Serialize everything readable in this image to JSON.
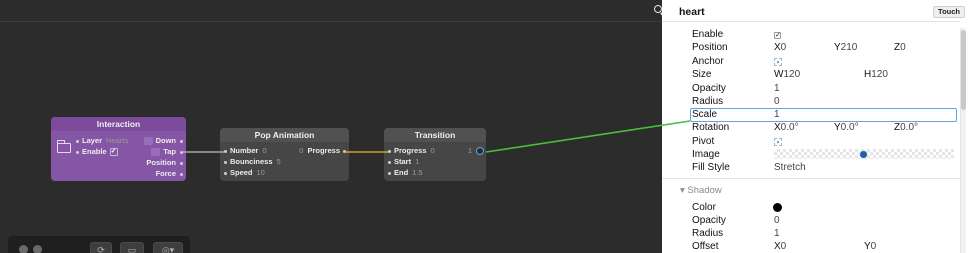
{
  "canvas": {
    "nodes": {
      "interaction": {
        "title": "Interaction",
        "inputs": [
          {
            "label": "Layer",
            "value": "Hearts"
          },
          {
            "label": "Enable",
            "value": "✓"
          }
        ],
        "outputs": [
          "Down",
          "Tap",
          "Position",
          "Force"
        ]
      },
      "pop": {
        "title": "Pop Animation",
        "inputs": [
          {
            "label": "Number",
            "value": "0"
          },
          {
            "label": "Bounciness",
            "value": "5"
          },
          {
            "label": "Speed",
            "value": "10"
          }
        ],
        "output": {
          "label": "Progress",
          "value": "0"
        }
      },
      "transition": {
        "title": "Transition",
        "inputs": [
          {
            "label": "Progress",
            "value": "0"
          },
          {
            "label": "Start",
            "value": "1"
          },
          {
            "label": "End",
            "value": "1.5"
          }
        ],
        "output": {
          "label": "",
          "value": "1"
        }
      }
    },
    "wire_colors": {
      "gray": "#bdbdbd",
      "yellow": "#e8b92e",
      "green": "#4bbd3f"
    },
    "toolbar_icons": [
      "record-icon",
      "refresh-icon",
      "camera-icon",
      "settings-icon"
    ]
  },
  "inspector": {
    "title": "heart",
    "touch_label": "Touch",
    "rows": {
      "enable": {
        "label": "Enable",
        "value": "✓"
      },
      "position": {
        "label": "Position",
        "x_lbl": "X",
        "x": "0",
        "y_lbl": "Y",
        "y": "210",
        "z_lbl": "Z",
        "z": "0"
      },
      "anchor": {
        "label": "Anchor"
      },
      "size": {
        "label": "Size",
        "w_lbl": "W",
        "w": "120",
        "h_lbl": "H",
        "h": "120"
      },
      "opacity": {
        "label": "Opacity",
        "value": "1"
      },
      "radius": {
        "label": "Radius",
        "value": "0"
      },
      "scale": {
        "label": "Scale",
        "value": "1"
      },
      "rotation": {
        "label": "Rotation",
        "x_lbl": "X",
        "x": "0.0°",
        "y_lbl": "Y",
        "y": "0.0°",
        "z_lbl": "Z",
        "z": "0.0°"
      },
      "pivot": {
        "label": "Pivot"
      },
      "image": {
        "label": "Image"
      },
      "fill_style": {
        "label": "Fill Style",
        "value": "Stretch"
      }
    },
    "shadow": {
      "header": "Shadow",
      "color": {
        "label": "Color",
        "value": "#000000"
      },
      "opacity": {
        "label": "Opacity",
        "value": "0"
      },
      "radius": {
        "label": "Radius",
        "value": "1"
      },
      "offset": {
        "label": "Offset",
        "x_lbl": "X",
        "x": "0",
        "y_lbl": "Y",
        "y": "0"
      }
    }
  }
}
